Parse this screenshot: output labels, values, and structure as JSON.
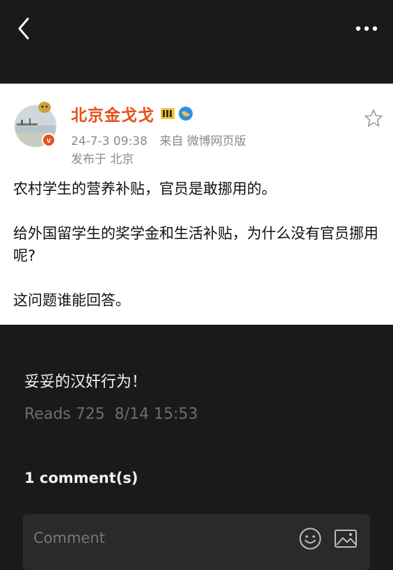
{
  "icons": {
    "back": "chevron-left-icon",
    "more": "more-dots-icon",
    "favorite": "star-outline-icon",
    "vip": "vip-badge-icon",
    "verified": "globe-badge-icon",
    "emoji": "emoji-smile-icon",
    "image": "image-icon"
  },
  "post": {
    "author": "北京金戈戈",
    "timestamp": "24-7-3 09:38",
    "source": "来自 微博网页版",
    "location": "发布于 北京",
    "paragraphs": [
      "农村学生的营养补贴，官员是敢挪用的。",
      "给外国留学生的奖学金和生活补贴，为什么没有官员挪用呢?",
      "这问题谁能回答。"
    ]
  },
  "caption": "妥妥的汉奸行为！",
  "stats": {
    "reads": "Reads 725",
    "datetime": "8/14 15:53"
  },
  "comments": {
    "count_label": "1 comment(s)",
    "placeholder": "Comment"
  },
  "colors": {
    "author_name": "#e8501a",
    "page_bg": "#1a1a1a",
    "card_bg": "#ffffff"
  }
}
